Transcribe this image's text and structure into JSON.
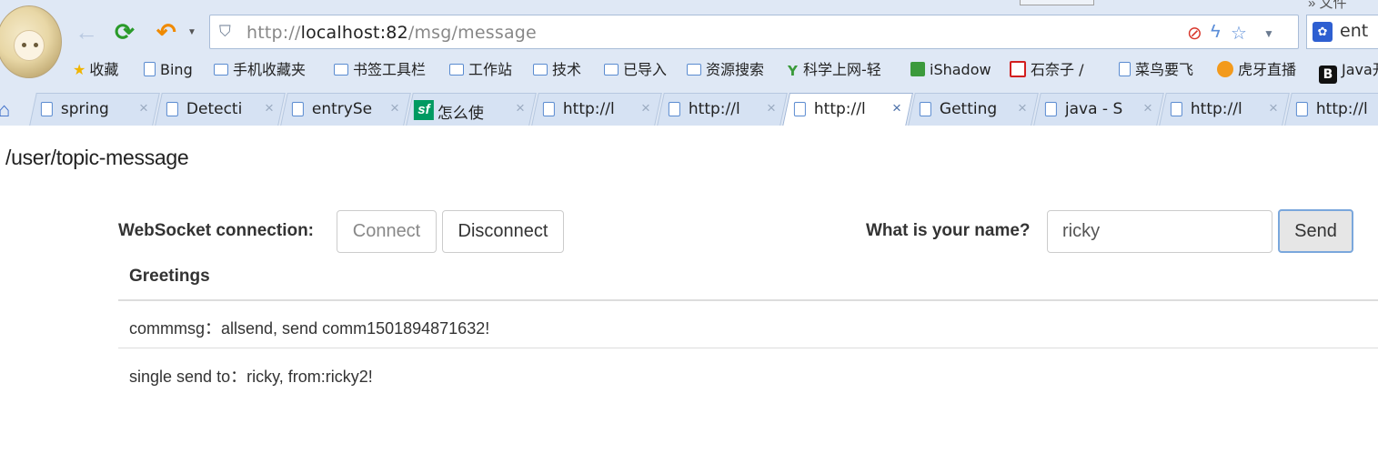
{
  "browser": {
    "url_host_prefix": "http://",
    "url_host": "localhost:82",
    "url_path": "/msg/message",
    "right_box_text": "ent",
    "top_right_text": "» 文件"
  },
  "bookmarks": [
    {
      "label": "收藏",
      "icon": "star-icon"
    },
    {
      "label": "Bing",
      "icon": "page-icon"
    },
    {
      "label": "手机收藏夹",
      "icon": "folder-icon"
    },
    {
      "label": "书签工具栏",
      "icon": "folder-icon"
    },
    {
      "label": "工作站",
      "icon": "folder-icon"
    },
    {
      "label": "技术",
      "icon": "folder-icon"
    },
    {
      "label": "已导入",
      "icon": "folder-icon"
    },
    {
      "label": "资源搜索",
      "icon": "folder-icon"
    },
    {
      "label": "科学上网-轻",
      "icon": "y-icon"
    },
    {
      "label": "iShadow",
      "icon": "ishadow-icon"
    },
    {
      "label": "石奈子 /",
      "icon": "red-icon"
    },
    {
      "label": "菜鸟要飞",
      "icon": "page-icon"
    },
    {
      "label": "虎牙直播",
      "icon": "huya-icon"
    },
    {
      "label": "Java开",
      "icon": "b-icon"
    }
  ],
  "tabs": [
    {
      "title": "spring",
      "icon": "page-icon",
      "active": false
    },
    {
      "title": "Detecti",
      "icon": "page-icon",
      "active": false
    },
    {
      "title": "entrySe",
      "icon": "page-icon",
      "active": false
    },
    {
      "title": "怎么使",
      "icon": "sf-icon",
      "active": false
    },
    {
      "title": "http://l",
      "icon": "page-icon",
      "active": false
    },
    {
      "title": "http://l",
      "icon": "page-icon",
      "active": false
    },
    {
      "title": "http://l",
      "icon": "page-icon",
      "active": true
    },
    {
      "title": "Getting",
      "icon": "page-icon",
      "active": false
    },
    {
      "title": "java - S",
      "icon": "page-icon",
      "active": false
    },
    {
      "title": "http://l",
      "icon": "page-icon",
      "active": false
    },
    {
      "title": "http://l",
      "icon": "page-icon",
      "active": false
    }
  ],
  "page": {
    "title": "/user/topic-message",
    "ws_label": "WebSocket connection:",
    "connect_label": "Connect",
    "disconnect_label": "Disconnect",
    "name_label": "What is your name?",
    "name_value": "ricky",
    "send_label": "Send",
    "greetings_header": "Greetings",
    "messages": [
      "commmsg：allsend, send comm1501894871632!",
      "single send to：ricky, from:ricky2!"
    ]
  },
  "colors": {
    "chrome_bg": "#dfe8f5",
    "send_border": "#7aa7dc",
    "refresh": "#2a9a2a",
    "undo": "#f08a00"
  }
}
